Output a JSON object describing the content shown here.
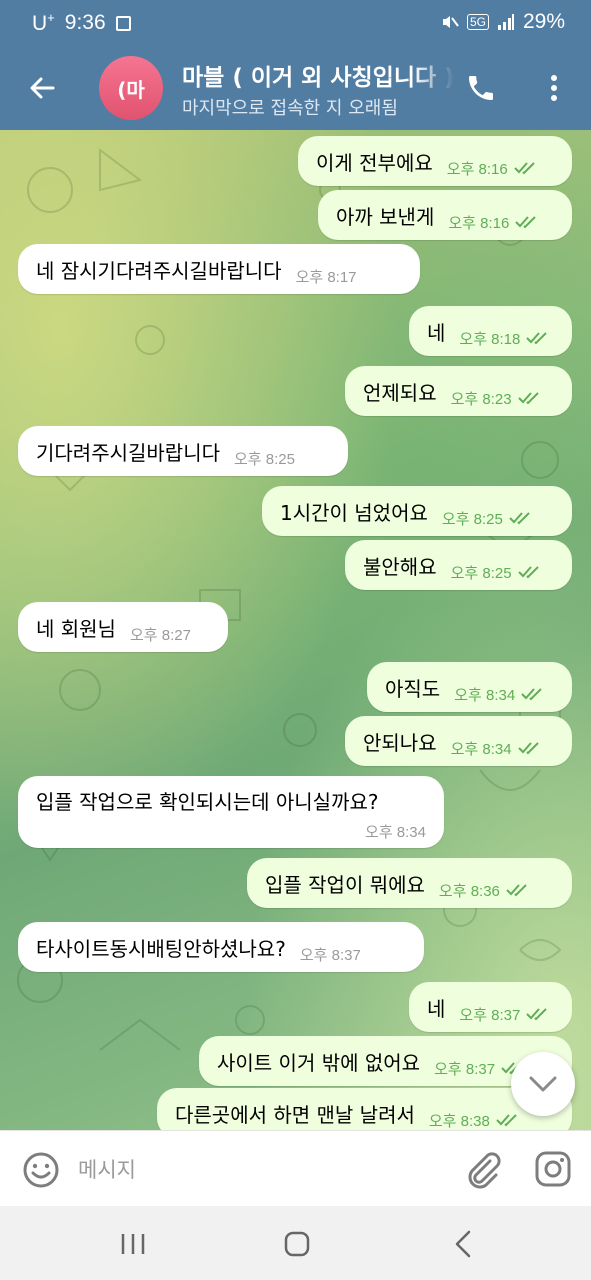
{
  "status_bar": {
    "carrier": "U",
    "carrier_sup": "+",
    "time": "9:36",
    "network": "5G",
    "battery": "29%"
  },
  "header": {
    "avatar_text": "(마",
    "title": "마블 ( 이거 외 사칭입니다 )",
    "status": "마지막으로 접속한 지 오래됨"
  },
  "messages": [
    {
      "dir": "out",
      "text": "이게 전부에요",
      "time": "오후 8:16"
    },
    {
      "dir": "out",
      "text": "아까 보낸게",
      "time": "오후 8:16"
    },
    {
      "dir": "in",
      "text": "네 잠시기다려주시길바랍니다",
      "time": "오후 8:17"
    },
    {
      "dir": "out",
      "text": "네",
      "time": "오후 8:18"
    },
    {
      "dir": "out",
      "text": "언제되요",
      "time": "오후 8:23"
    },
    {
      "dir": "in",
      "text": "기다려주시길바랍니다",
      "time": "오후 8:25"
    },
    {
      "dir": "out",
      "text": "1시간이 넘었어요",
      "time": "오후 8:25"
    },
    {
      "dir": "out",
      "text": "불안해요",
      "time": "오후 8:25"
    },
    {
      "dir": "in",
      "text": "네 회원님",
      "time": "오후 8:27"
    },
    {
      "dir": "out",
      "text": "아직도",
      "time": "오후 8:34"
    },
    {
      "dir": "out",
      "text": "안되나요",
      "time": "오후 8:34"
    },
    {
      "dir": "in",
      "text": "입플 작업으로 확인되시는데 아니실까요?",
      "time": "오후 8:34"
    },
    {
      "dir": "out",
      "text": "입플 작업이 뭐에요",
      "time": "오후 8:36"
    },
    {
      "dir": "in",
      "text": "타사이트동시배팅안하셨나요?",
      "time": "오후 8:37"
    },
    {
      "dir": "out",
      "text": "네",
      "time": "오후 8:37"
    },
    {
      "dir": "out",
      "text": "사이트 이거 밖에 없어요",
      "time": "오후 8:37"
    },
    {
      "dir": "out",
      "text": "다른곳에서 하면 맨날 날려서",
      "time": "오후 8:38"
    }
  ],
  "input": {
    "placeholder": "메시지"
  },
  "colors": {
    "header": "#527da3",
    "outgoing_bubble": "#effedd",
    "incoming_bubble": "#ffffff",
    "time_out": "#5fae57"
  },
  "icons": [
    "back-arrow-icon",
    "phone-icon",
    "more-vert-icon",
    "double-check-icon",
    "chevron-down-icon",
    "emoji-icon",
    "paperclip-icon",
    "camera-icon"
  ]
}
